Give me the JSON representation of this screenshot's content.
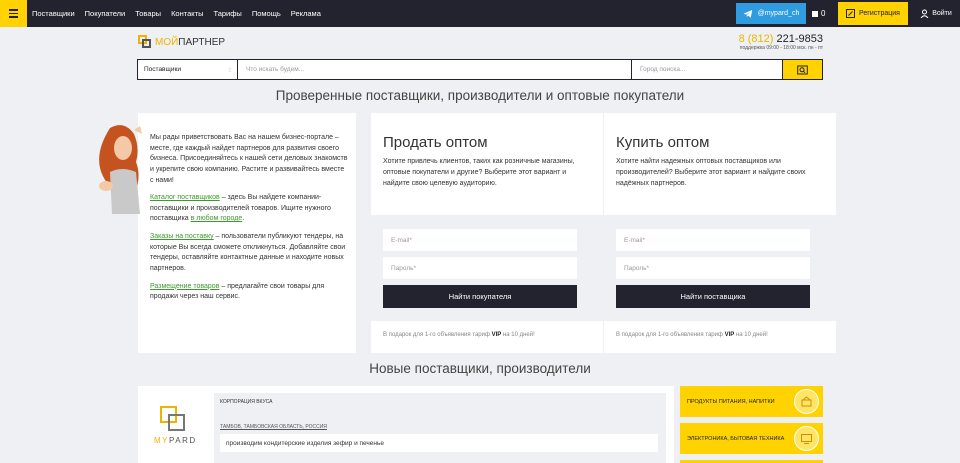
{
  "topbar": {
    "nav": [
      "Поставщики",
      "Покупатели",
      "Товары",
      "Контакты",
      "Тарифы",
      "Помощь",
      "Реклама"
    ],
    "telegram": "@mypard_ch",
    "messages_count": "0",
    "register": "Регистрация",
    "login": "Войти"
  },
  "header": {
    "logo_part1": "МОЙ",
    "logo_part2": "ПАРТНЕР",
    "phone_code": "8 (812)",
    "phone_number": "221-9853",
    "hours": "поддержка 09:00 - 18:00 мск. пн - пт"
  },
  "search": {
    "category": "Поставщики",
    "query_placeholder": "Что искать будем...",
    "city_placeholder": "Город поиска..."
  },
  "headline": "Проверенные поставщики, производители и оптовые покупатели",
  "welcome": {
    "intro": "Мы рады приветствовать Вас на нашем бизнес-портале – месте, где каждый найдет партнеров для развития своего бизнеса. Присоединяйтесь к нашей сети деловых знакомств и укрепите свою компанию. Растите и развивайтесь вместе с нами!",
    "catalog_link": "Каталог поставщиков",
    "catalog_text": " – здесь Вы найдете компании-поставщики и производителей товаров. Ищите нужного поставщика ",
    "catalog_link2": "в любом городе",
    "catalog_end": ".",
    "orders_link": "Заказы на поставку",
    "orders_text": " – пользователи публикуют тендеры, на которые Вы всегда сможете откликнуться. Добавляйте свои тендеры, оставляйте контактные данные и находите новых партнеров.",
    "place_link": "Размещение товаров",
    "place_text": " – предлагайте свои товары для продажи через наш сервис."
  },
  "sell": {
    "title": "Продать оптом",
    "desc": "Хотите привлечь клиентов, таких как розничные магазины, оптовые покупатели и другие? Выберите этот вариант и найдите свою целевую аудиторию.",
    "email": "E-mail*",
    "password": "Пароль*",
    "button": "Найти покупателя",
    "gift_pre": "В подарок для 1-го объявления тариф ",
    "gift_vip": "VIP",
    "gift_post": " на 10 дней!"
  },
  "buy": {
    "title": "Купить оптом",
    "desc": "Хотите найти надежных оптовых поставщиков или производителей? Выберите этот вариант и найдите своих надёжных партнеров.",
    "email": "E-mail*",
    "password": "Пароль*",
    "button": "Найти поставщика",
    "gift_pre": "В подарок для 1-го объявления тариф ",
    "gift_vip": "VIP",
    "gift_post": " на 10 дней!"
  },
  "new_suppliers_title": "Новые поставщики, производители",
  "supplier": {
    "logo_a": "MY",
    "logo_b": "PARD",
    "name": "КОРПОРАЦИЯ ВКУСА",
    "location": "ТАМБОВ, ТАМБОВСКАЯ ОБЛАСТЬ, РОССИЯ",
    "description": "производим кондитерские изделия зефир и печенье"
  },
  "categories": [
    "ПРОДУКТЫ ПИТАНИЯ, НАПИТКИ",
    "ЭЛЕКТРОНИКА, БЫТОВАЯ ТЕХНИКА"
  ],
  "colors": {
    "accent": "#ffd200",
    "dark": "#23232f",
    "link": "#3a9b2a",
    "telegram": "#2f9be0"
  }
}
